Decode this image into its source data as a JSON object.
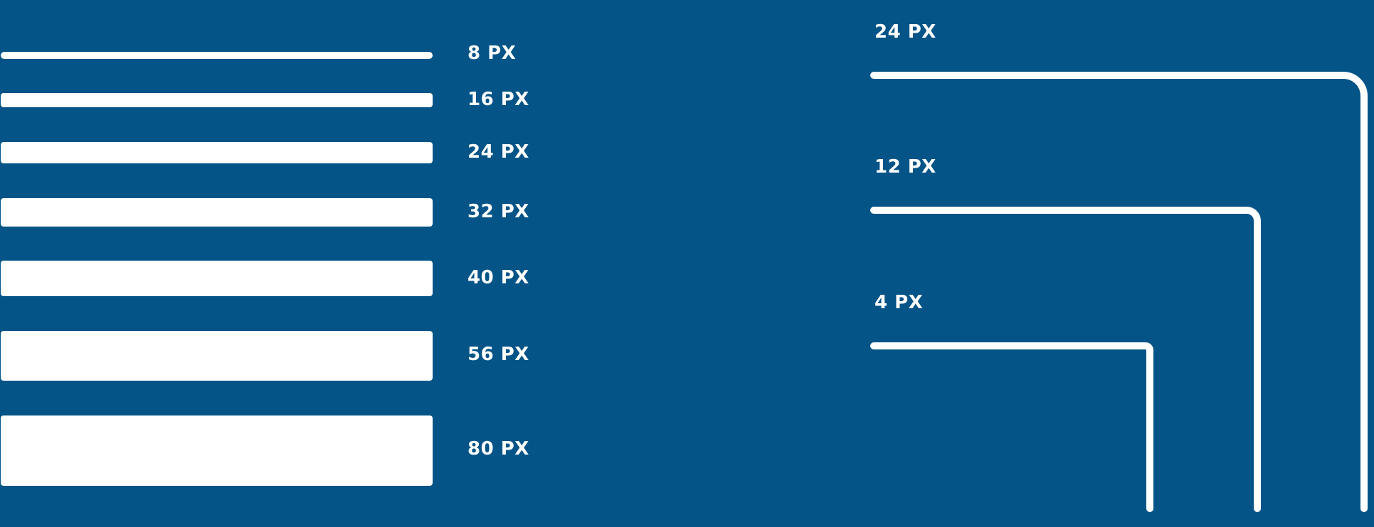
{
  "colors": {
    "background": "#045487",
    "stroke": "#ffffff"
  },
  "bars": [
    {
      "label": "8 PX"
    },
    {
      "label": "16 PX"
    },
    {
      "label": "24 PX"
    },
    {
      "label": "32 PX"
    },
    {
      "label": "40 PX"
    },
    {
      "label": "56 PX"
    },
    {
      "label": "80 PX"
    }
  ],
  "corners": [
    {
      "label": "24 PX"
    },
    {
      "label": "12 PX"
    },
    {
      "label": "4 PX"
    }
  ]
}
